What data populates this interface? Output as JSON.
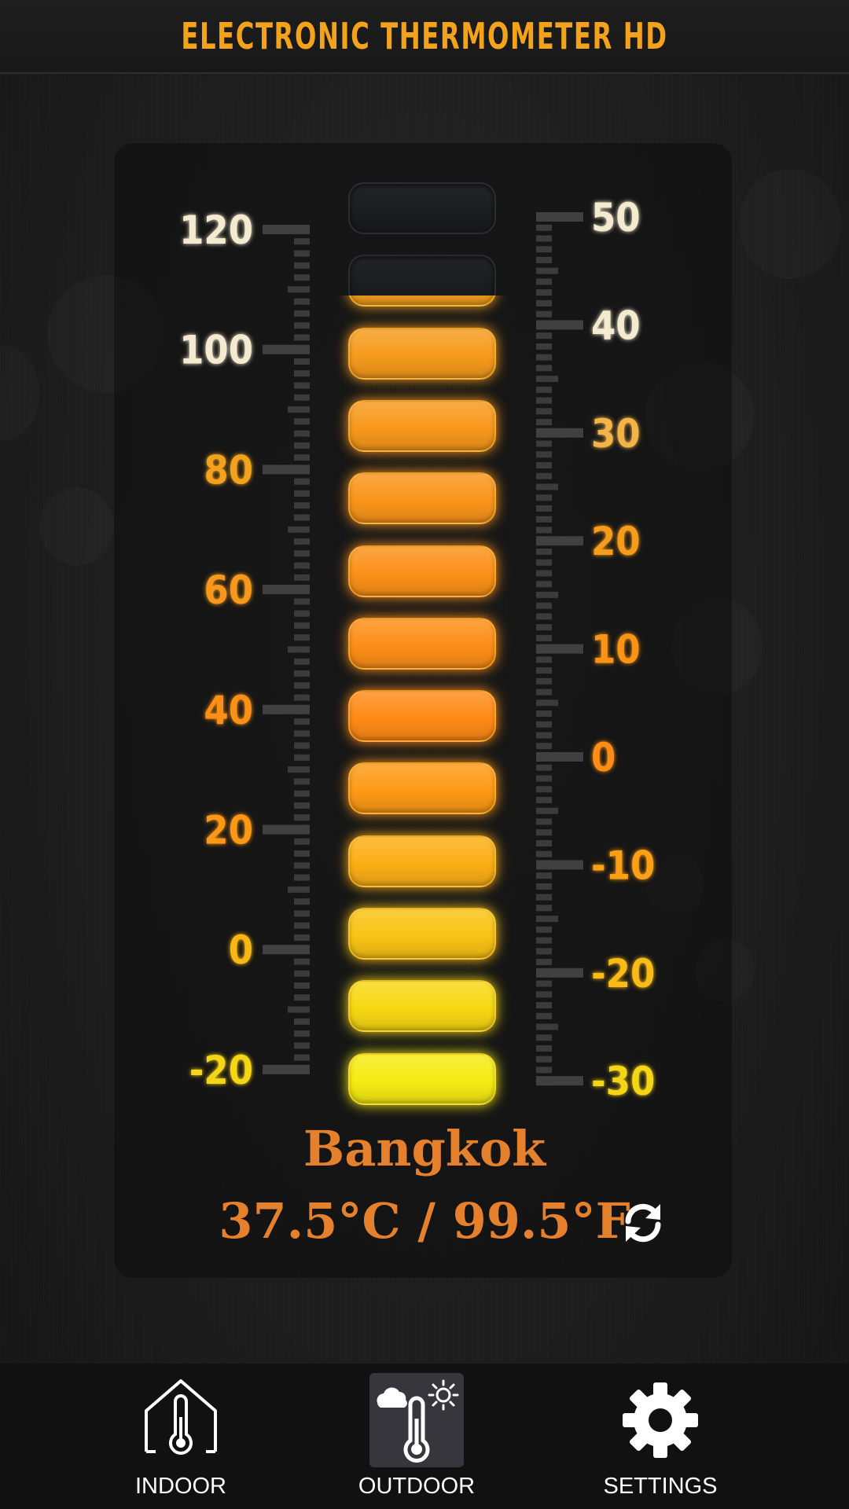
{
  "app": {
    "title": "ELECTRONIC THERMOMETER HD"
  },
  "thermometer": {
    "fahrenheit_scale": [
      "120",
      "100",
      "80",
      "60",
      "40",
      "20",
      "0",
      "-20"
    ],
    "celsius_scale": [
      "50",
      "40",
      "30",
      "20",
      "10",
      "0",
      "-10",
      "-20",
      "-30"
    ],
    "segments_total": 13,
    "segments_lit": 11,
    "level_fraction": 0.88
  },
  "readout": {
    "city": "Bangkok",
    "temperature": "37.5°C / 99.5°F"
  },
  "nav": {
    "indoor": "INDOOR",
    "outdoor": "OUTDOOR",
    "settings": "SETTINGS",
    "active": "outdoor"
  },
  "colors": {
    "title": "#f3a21c",
    "readout": "#e5802d",
    "segment_top": "#f2a21e",
    "segment_mid": "#ff8a16",
    "segment_bottom": "#f5ec12"
  }
}
